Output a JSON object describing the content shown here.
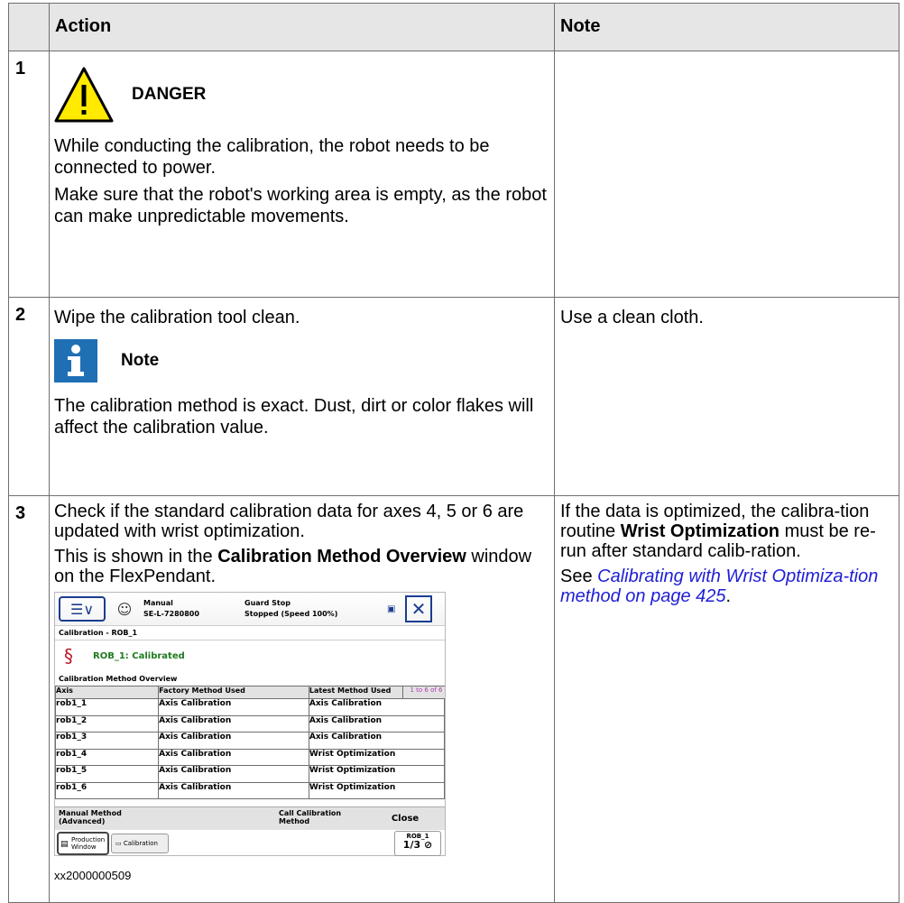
{
  "headers": {
    "action": "Action",
    "note": "Note"
  },
  "rows": [
    {
      "num": "1",
      "danger_label": "DANGER",
      "para1": "While conducting the calibration, the robot needs to be connected to power.",
      "para2": "Make sure that the robot's working area is empty, as the robot can make unpredictable movements."
    },
    {
      "num": "2",
      "para1": "Wipe the calibration tool clean.",
      "note_label": "Note",
      "para2": "The calibration method is exact. Dust, dirt or color flakes will affect the calibration value.",
      "note": "Use a clean cloth."
    },
    {
      "num": "3",
      "para1": "Check if the standard calibration data for axes 4, 5 or 6 are updated with wrist optimization.",
      "para2_a": "This is shown in the ",
      "para2_b": "Calibration Method Overview",
      "para2_c": " window on the FlexPendant.",
      "note1_a": "If the data is optimized, the calibra-tion routine ",
      "note1_b": "Wrist Optimization",
      "note1_c": " must be re-run after standard calib-ration.",
      "note2_a": "See ",
      "note2_link": "Calibrating with Wrist Optimiza-tion method on page 425",
      "note2_c": ".",
      "caption": "xx2000000509"
    }
  ],
  "pendant": {
    "mode": "Manual",
    "controller": "SE-L-7280800",
    "state": "Guard Stop",
    "speed": "Stopped (Speed 100%)",
    "crumb": "Calibration - ROB_1",
    "status": "ROB_1:  Calibrated",
    "section": "Calibration Method Overview",
    "col_axis": "Axis",
    "col_factory": "Factory Method Used",
    "col_latest": "Latest Method Used",
    "count": "1 to 6 of 6",
    "axes": [
      {
        "axis": "rob1_1",
        "factory": "Axis Calibration",
        "latest": "Axis Calibration"
      },
      {
        "axis": "rob1_2",
        "factory": "Axis Calibration",
        "latest": "Axis Calibration"
      },
      {
        "axis": "rob1_3",
        "factory": "Axis Calibration",
        "latest": "Axis Calibration"
      },
      {
        "axis": "rob1_4",
        "factory": "Axis Calibration",
        "latest": "Wrist Optimization"
      },
      {
        "axis": "rob1_5",
        "factory": "Axis Calibration",
        "latest": "Wrist Optimization"
      },
      {
        "axis": "rob1_6",
        "factory": "Axis Calibration",
        "latest": "Wrist Optimization"
      }
    ],
    "btn_manual_1": "Manual Method",
    "btn_manual_2": "(Advanced)",
    "btn_call_1": "Call Calibration",
    "btn_call_2": "Method",
    "btn_close": "Close",
    "task_production_1": "Production",
    "task_production_2": "Window",
    "task_calibration": "Calibration",
    "task_rob": "ROB_1",
    "task_fraction": "1/3"
  },
  "colors": {
    "header_bg": "#e6e6e6",
    "link": "#1e1ed6",
    "warning_yellow": "#ffea00",
    "info_blue": "#1f6fb5",
    "status_green": "#1f7a1f"
  },
  "icons": [
    "warning-icon",
    "info-icon",
    "menu-icon",
    "event-log-icon",
    "close-icon",
    "robot-icon"
  ]
}
